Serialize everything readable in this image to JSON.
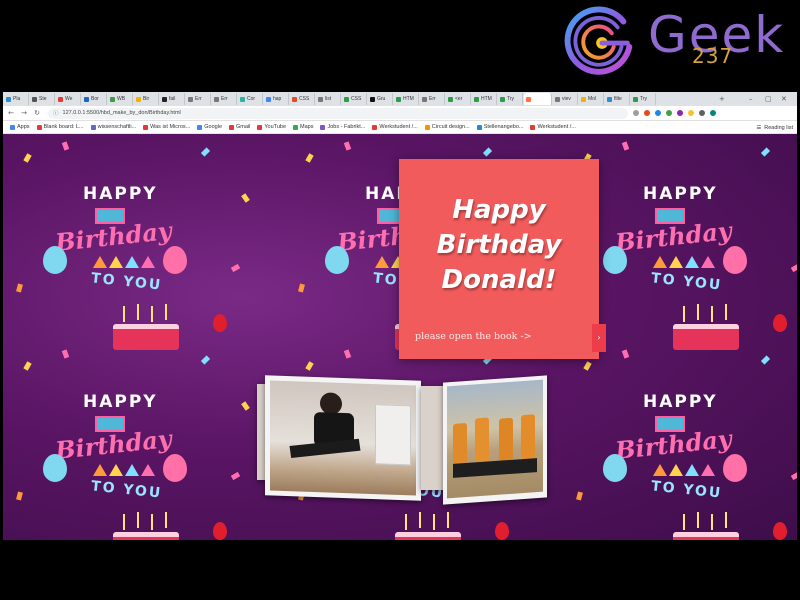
{
  "brand": {
    "word": "Geek",
    "number": "237"
  },
  "browser": {
    "tabs": [
      {
        "label": "Pla",
        "color": "#2a8dd4"
      },
      {
        "label": "Ste",
        "color": "#555555"
      },
      {
        "label": "We",
        "color": "#e53935"
      },
      {
        "label": "Bor",
        "color": "#1e63c9"
      },
      {
        "label": "WB",
        "color": "#3f9b45"
      },
      {
        "label": "Bir",
        "color": "#f0b400"
      },
      {
        "label": "fail",
        "color": "#222222"
      },
      {
        "label": "Err",
        "color": "#777777"
      },
      {
        "label": "Err",
        "color": "#777777"
      },
      {
        "label": "Cor",
        "color": "#2db3a6"
      },
      {
        "label": "hap",
        "color": "#4285f4"
      },
      {
        "label": "CSS",
        "color": "#e44d26"
      },
      {
        "label": "list",
        "color": "#777777"
      },
      {
        "label": "CSS",
        "color": "#2f9b4a"
      },
      {
        "label": "Gru",
        "color": "#111111"
      },
      {
        "label": "HTM",
        "color": "#2f9b4a"
      },
      {
        "label": "Err",
        "color": "#777777"
      },
      {
        "label": "<er",
        "color": "#2f9b4a"
      },
      {
        "label": "HTM",
        "color": "#2f9b4a"
      },
      {
        "label": "Try",
        "color": "#2f9b4a"
      },
      {
        "label": "",
        "color": "#ff7043",
        "active": true
      },
      {
        "label": "viev",
        "color": "#777777"
      },
      {
        "label": "Mol",
        "color": "#f0b400"
      },
      {
        "label": "filte",
        "color": "#2a8dd4"
      },
      {
        "label": "Try",
        "color": "#2f9b4a"
      }
    ],
    "new_tab_glyph": "+",
    "window_controls": [
      "–",
      "▢",
      "✕"
    ],
    "url": "127.0.0.1:5500/hbd_make_by_don/Birthday.html",
    "extension_colors": [
      "#9e9e9e",
      "#e64a19",
      "#1e88e5",
      "#43a047",
      "#8e24aa",
      "#fbc02d",
      "#616161",
      "#00897b"
    ],
    "bookmarks": [
      {
        "label": "Apps",
        "color": "#4285f4"
      },
      {
        "label": "Blank board: L...",
        "color": "#e53935"
      },
      {
        "label": "wissenschaftli...",
        "color": "#5c6bc0"
      },
      {
        "label": "Was ist Micros...",
        "color": "#e53935"
      },
      {
        "label": "Google",
        "color": "#4285f4"
      },
      {
        "label": "Gmail",
        "color": "#e53935"
      },
      {
        "label": "YouTube",
        "color": "#e53935"
      },
      {
        "label": "Maps",
        "color": "#34a853"
      },
      {
        "label": "Jobs - Fabrikt...",
        "color": "#7e57c2"
      },
      {
        "label": "Werkstudent /...",
        "color": "#e53935"
      },
      {
        "label": "Circuit design...",
        "color": "#ff8f00"
      },
      {
        "label": "Stellenangebo...",
        "color": "#1e88e5"
      },
      {
        "label": "Werkstudent /...",
        "color": "#e53935"
      }
    ],
    "reading_list": "Reading list"
  },
  "card": {
    "title_lines": [
      "Happy",
      "Birthday",
      "Donald!"
    ],
    "hint": "please open the book ->",
    "next_glyph": "›"
  },
  "background_tile": {
    "happy": "HAPPY",
    "birthday": "Birthday",
    "to_you": "TO YOU"
  }
}
